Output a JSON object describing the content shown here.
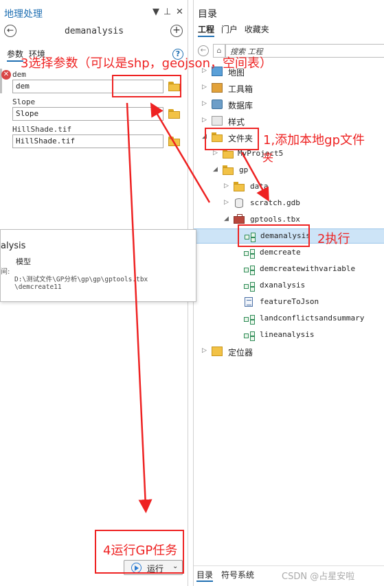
{
  "gp": {
    "title": "地理处理",
    "ctrl_dropdown": "▼",
    "ctrl_pin": "⊥",
    "ctrl_close": "✕",
    "back_glyph": "←",
    "add_glyph": "+",
    "tool_name": "demanalysis",
    "tabs": [
      "参数",
      "环境"
    ],
    "help_glyph": "?",
    "params": [
      {
        "label": "dem",
        "value": "dem"
      },
      {
        "label": "Slope",
        "value": "Slope"
      },
      {
        "label": "HillShade.tif",
        "value": "HillShade.tif"
      }
    ],
    "error_glyph": "✕",
    "tooltip": {
      "title": "alysis",
      "type": "模型",
      "label": "间:",
      "path_line1": "D:\\测试文件\\GP分析\\gp\\gp\\gptools.tbx",
      "path_line2": "\\demcreate11"
    },
    "run_label": "运行",
    "run_caret": "⌄"
  },
  "catalog": {
    "title": "目录",
    "tabs": [
      "工程",
      "门户",
      "收藏夹"
    ],
    "search_placeholder": "搜索 工程",
    "home_glyph": "⌂",
    "back_glyph": "←",
    "tree": [
      {
        "label": "地图"
      },
      {
        "label": "工具箱"
      },
      {
        "label": "数据库"
      },
      {
        "label": "样式"
      },
      {
        "label": "文件夹"
      },
      {
        "label": "MyProject5"
      },
      {
        "label": "gp"
      },
      {
        "label": "data"
      },
      {
        "label": "scratch.gdb"
      },
      {
        "label": "gptools.tbx"
      },
      {
        "label": "demanalysis"
      },
      {
        "label": "demcreate"
      },
      {
        "label": "demcreatewithvariable"
      },
      {
        "label": "dxanalysis"
      },
      {
        "label": "featureToJson"
      },
      {
        "label": "landconflictsandsummary"
      },
      {
        "label": "lineanalysis"
      },
      {
        "label": "定位器"
      }
    ],
    "arrow_collapsed": "▷",
    "arrow_expanded": "◢",
    "bottom_tabs": [
      "目录",
      "符号系统"
    ],
    "watermark": "CSDN @占星安啦"
  },
  "annotations": {
    "step1": "1,添加本地gp文件",
    "step1_tail": "夹",
    "step2": "2执行",
    "step3": "3选择参数（可以是shp，geojson，空间表）",
    "step4": "4运行GP任务",
    "color": "#ee2222"
  }
}
